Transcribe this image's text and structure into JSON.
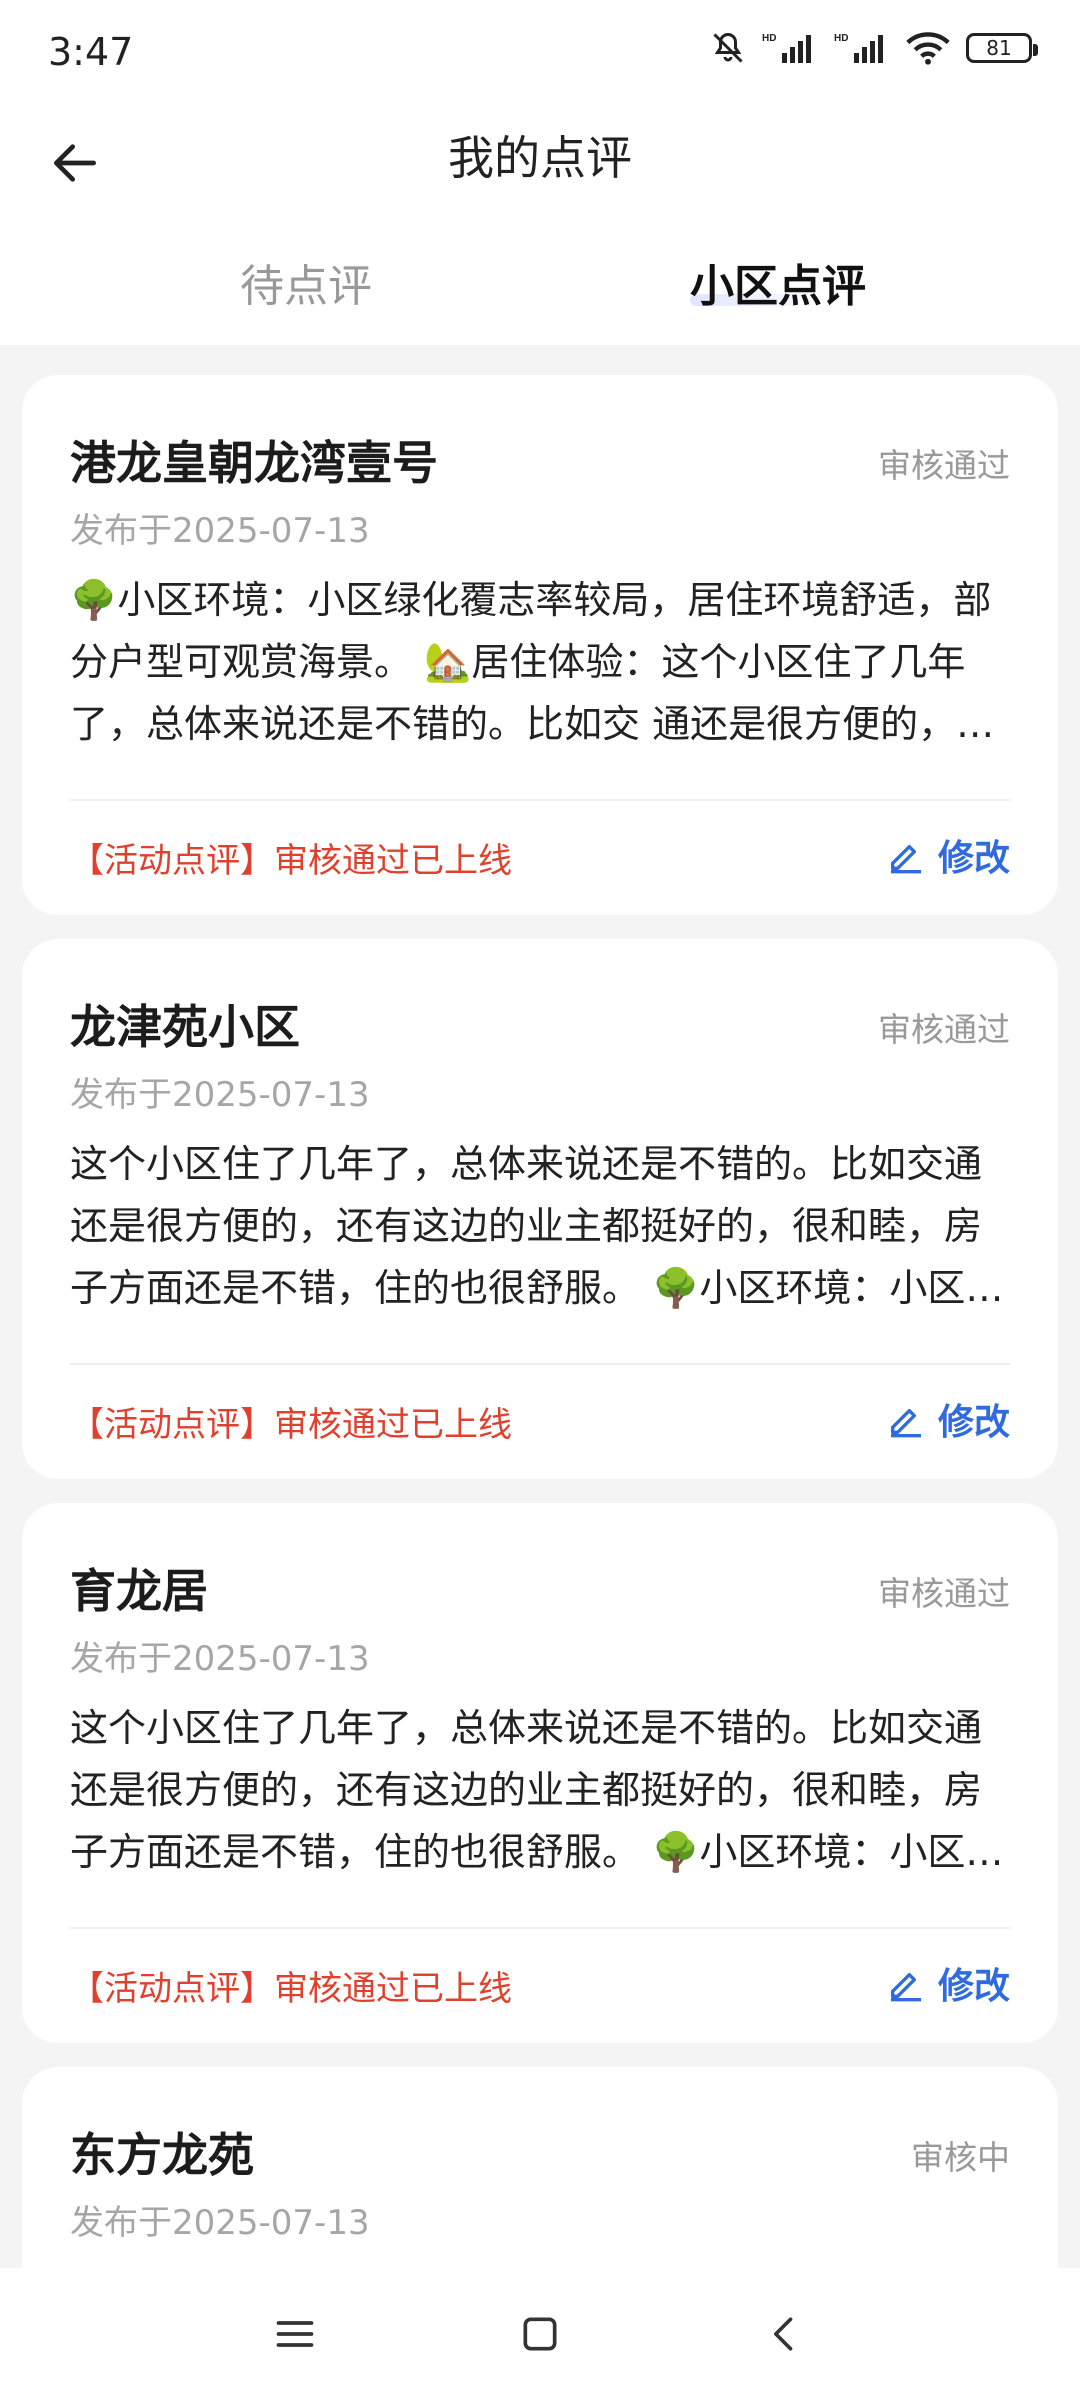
{
  "status_bar": {
    "time": "3:47",
    "battery": "81",
    "icons": [
      "mute-bell-icon",
      "hd-signal-icon",
      "hd-signal-icon",
      "wifi-icon",
      "battery-icon"
    ]
  },
  "header": {
    "title": "我的点评",
    "back_icon": "arrow-left-icon"
  },
  "tabs": [
    {
      "label": "待点评",
      "active": false
    },
    {
      "label": "小区点评",
      "active": true
    }
  ],
  "reviews": [
    {
      "title": "港龙皇朝龙湾壹号",
      "status": "审核通过",
      "date": "发布于2025-07-13",
      "text": "🌳小区环境：小区绿化覆志率较局，居住环境舒适，部分户型可观赏海景。 🏡居住体验：这个小区住了几年了，总体来说还是不错的。比如交 通还是很方便的，还有这边的业主都挺好的",
      "activity": "【活动点评】审核通过已上线",
      "edit_label": "修改"
    },
    {
      "title": "龙津苑小区",
      "status": "审核通过",
      "date": "发布于2025-07-13",
      "text": "这个小区住了几年了，总体来说还是不错的。比如交通还是很方便的，还有这边的业主都挺好的，很和睦，房子方面还是不错，住的也很舒服。 🌳小区环境：小区绿化覆盖率较高",
      "activity": "【活动点评】审核通过已上线",
      "edit_label": "修改"
    },
    {
      "title": "育龙居",
      "status": "审核通过",
      "date": "发布于2025-07-13",
      "text": "这个小区住了几年了，总体来说还是不错的。比如交通还是很方便的，还有这边的业主都挺好的，很和睦，房子方面还是不错，住的也很舒服。 🌳小区环境：小区绿化覆盖率较高",
      "activity": "【活动点评】审核通过已上线",
      "edit_label": "修改"
    },
    {
      "title": "东方龙苑",
      "status": "审核中",
      "date": "发布于2025-07-13"
    }
  ],
  "colors": {
    "accent_blue": "#2f6bde",
    "activity_red": "#e0402e",
    "muted_gray": "#999999",
    "background": "#f4f4f4"
  }
}
